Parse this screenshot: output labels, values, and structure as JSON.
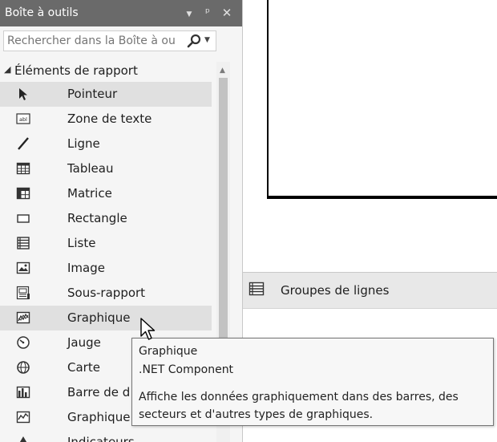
{
  "toolbox": {
    "title": "Boîte à outils",
    "header_icons": [
      "dropdown-icon",
      "pin-icon",
      "close-icon"
    ],
    "search": {
      "value": "",
      "placeholder": "Rechercher dans la Boîte à ou"
    },
    "group": {
      "label": "Éléments de rapport",
      "expanded": true
    },
    "items": [
      {
        "label": "Pointeur",
        "icon": "pointer-icon",
        "selected": true
      },
      {
        "label": "Zone de texte",
        "icon": "textbox-icon"
      },
      {
        "label": "Ligne",
        "icon": "line-icon"
      },
      {
        "label": "Tableau",
        "icon": "table-icon"
      },
      {
        "label": "Matrice",
        "icon": "matrix-icon"
      },
      {
        "label": "Rectangle",
        "icon": "rectangle-icon"
      },
      {
        "label": "Liste",
        "icon": "list-icon"
      },
      {
        "label": "Image",
        "icon": "image-icon"
      },
      {
        "label": "Sous-rapport",
        "icon": "subreport-icon"
      },
      {
        "label": "Graphique",
        "icon": "chart-icon",
        "hovered": true
      },
      {
        "label": "Jauge",
        "icon": "gauge-icon"
      },
      {
        "label": "Carte",
        "icon": "map-icon"
      },
      {
        "label": "Barre de d",
        "icon": "databar-icon"
      },
      {
        "label": "Graphique",
        "icon": "sparkline-icon"
      },
      {
        "label": "Indicateurs",
        "icon": "indicator-icon"
      }
    ]
  },
  "groups_pane": {
    "label": "Groupes de lignes"
  },
  "tooltip": {
    "title": "Graphique",
    "subtitle": ".NET Component",
    "desc_line1": "Affiche les données graphiquement dans des barres, des",
    "desc_line2": "secteurs et d'autres types de graphiques."
  },
  "colors": {
    "header_bg": "#6a6a6a",
    "panel_bg": "#f5f5f5",
    "selected_bg": "#e0e0e0",
    "tooltip_bg": "#f7f7f7"
  }
}
